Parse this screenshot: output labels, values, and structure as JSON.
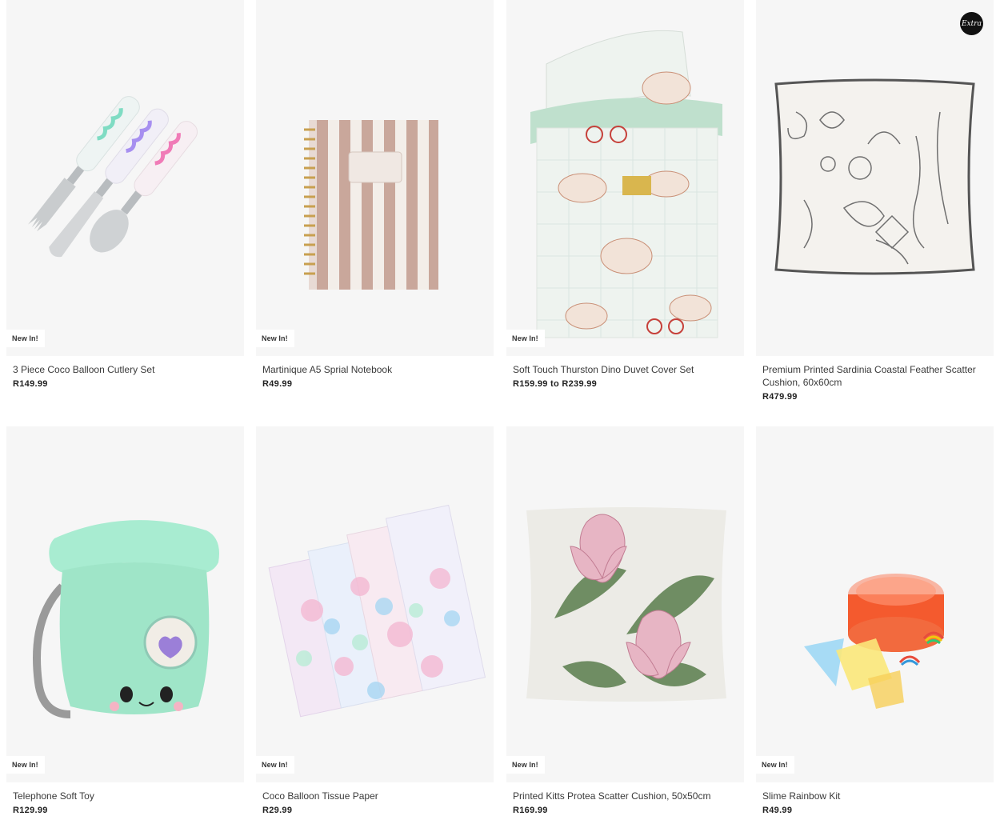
{
  "badge_text": "New In!",
  "logo_text": "Extra",
  "products": [
    {
      "name": "3 Piece Coco Balloon Cutlery Set",
      "price": "R149.99",
      "badge": "New In!",
      "image_icon": "cutlery-set-image"
    },
    {
      "name": "Martinique A5 Sprial Notebook",
      "price": "R49.99",
      "badge": "New In!",
      "image_icon": "notebook-image"
    },
    {
      "name": "Soft Touch Thurston Dino Duvet Cover Set",
      "price": "R159.99 to R239.99",
      "badge": "New In!",
      "image_icon": "duvet-cover-image"
    },
    {
      "name": "Premium Printed Sardinia Coastal Feather Scatter Cushion, 60x60cm",
      "price": "R479.99",
      "badge": "",
      "image_icon": "coastal-cushion-image"
    },
    {
      "name": "Telephone Soft Toy",
      "price": "R129.99",
      "badge": "New In!",
      "image_icon": "telephone-toy-image"
    },
    {
      "name": "Coco Balloon Tissue Paper",
      "price": "R29.99",
      "badge": "New In!",
      "image_icon": "tissue-paper-image"
    },
    {
      "name": "Printed Kitts Protea Scatter Cushion, 50x50cm",
      "price": "R169.99",
      "badge": "New In!",
      "image_icon": "protea-cushion-image"
    },
    {
      "name": "Slime Rainbow Kit",
      "price": "R49.99",
      "badge": "New In!",
      "image_icon": "slime-kit-image"
    }
  ],
  "colors": {
    "card_bg": "#f6f6f6",
    "text": "#2b2b2b",
    "badge_bg": "#ffffff"
  }
}
